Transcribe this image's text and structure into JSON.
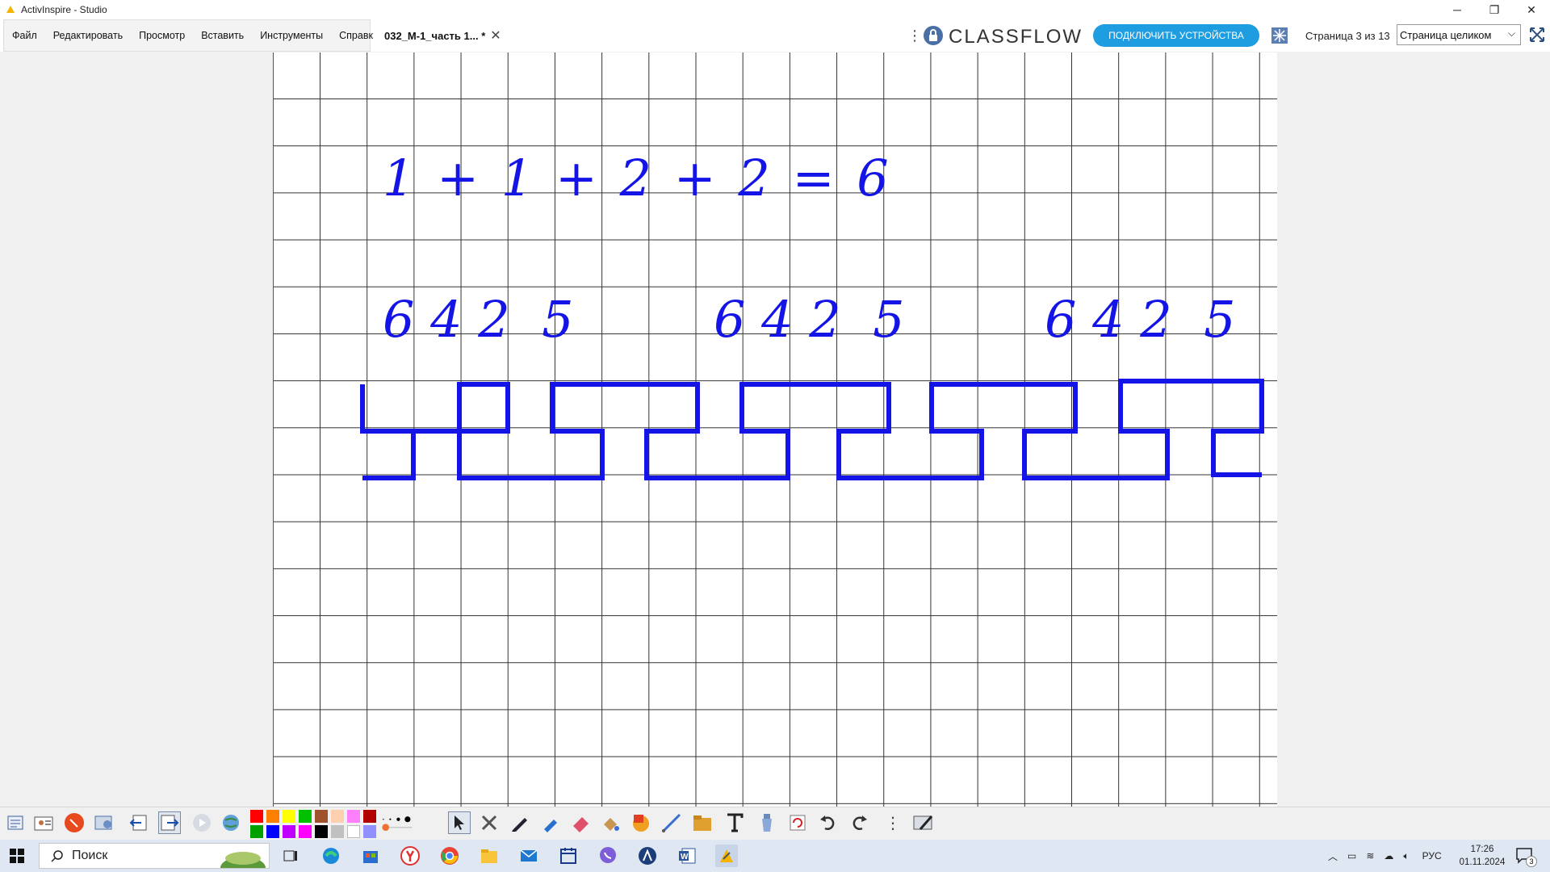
{
  "window": {
    "title": "ActivInspire - Studio"
  },
  "menu": {
    "items": [
      "Файл",
      "Редактировать",
      "Просмотр",
      "Вставить",
      "Инструменты",
      "Справка"
    ]
  },
  "document_tab": {
    "label": "032_М-1_часть 1... *",
    "close": "✕"
  },
  "classflow": {
    "logo_text": "CLASSFLOW",
    "connect_button": "ПОДКЛЮЧИТЬ УСТРОЙСТВА"
  },
  "page_info": "Страница 3 из 13",
  "zoom": {
    "selected": "Страница целиком"
  },
  "board": {
    "equation": "1 + 1 + 2 + 2 = 6",
    "number_groups": [
      "6 4 2  5",
      "6 4 2  5",
      "6 4 2  5"
    ]
  },
  "toolbar": {
    "colors": [
      "#ff0000",
      "#ff8000",
      "#ffff00",
      "#00c000",
      "#a0522d",
      "#ffd0b0",
      "#ff80ff",
      "#b00000",
      "#00a000",
      "#0000ff",
      "#c000ff",
      "#ff00ff",
      "#000000",
      "#c0c0c0",
      "#ffffff",
      "#9090ff"
    ]
  },
  "taskbar": {
    "search_placeholder": "Поиск",
    "language": "РУС",
    "time": "17:26",
    "date": "01.11.2024",
    "notifications": "3"
  },
  "colors": {
    "ink": "#1414e6",
    "accent": "#1e9de0"
  }
}
